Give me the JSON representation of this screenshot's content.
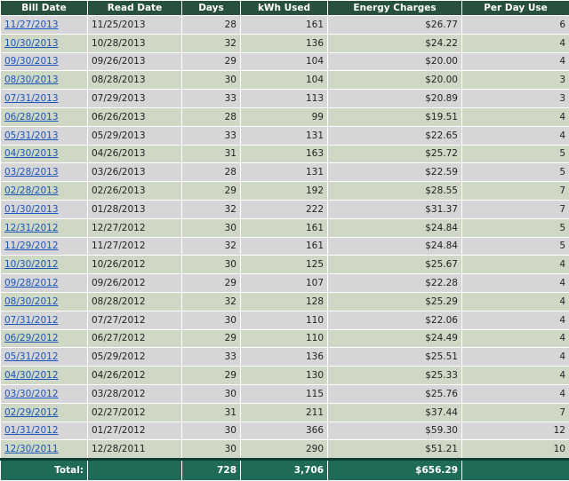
{
  "headers": {
    "bill_date": "Bill Date",
    "read_date": "Read Date",
    "days": "Days",
    "kwh": "kWh Used",
    "charges": "Energy Charges",
    "per_day": "Per Day Use"
  },
  "rows": [
    {
      "bill_date": "11/27/2013",
      "read_date": "11/25/2013",
      "days": "28",
      "kwh": "161",
      "charges": "$26.77",
      "per_day": "6"
    },
    {
      "bill_date": "10/30/2013",
      "read_date": "10/28/2013",
      "days": "32",
      "kwh": "136",
      "charges": "$24.22",
      "per_day": "4"
    },
    {
      "bill_date": "09/30/2013",
      "read_date": "09/26/2013",
      "days": "29",
      "kwh": "104",
      "charges": "$20.00",
      "per_day": "4"
    },
    {
      "bill_date": "08/30/2013",
      "read_date": "08/28/2013",
      "days": "30",
      "kwh": "104",
      "charges": "$20.00",
      "per_day": "3"
    },
    {
      "bill_date": "07/31/2013",
      "read_date": "07/29/2013",
      "days": "33",
      "kwh": "113",
      "charges": "$20.89",
      "per_day": "3"
    },
    {
      "bill_date": "06/28/2013",
      "read_date": "06/26/2013",
      "days": "28",
      "kwh": "99",
      "charges": "$19.51",
      "per_day": "4"
    },
    {
      "bill_date": "05/31/2013",
      "read_date": "05/29/2013",
      "days": "33",
      "kwh": "131",
      "charges": "$22.65",
      "per_day": "4"
    },
    {
      "bill_date": "04/30/2013",
      "read_date": "04/26/2013",
      "days": "31",
      "kwh": "163",
      "charges": "$25.72",
      "per_day": "5"
    },
    {
      "bill_date": "03/28/2013",
      "read_date": "03/26/2013",
      "days": "28",
      "kwh": "131",
      "charges": "$22.59",
      "per_day": "5"
    },
    {
      "bill_date": "02/28/2013",
      "read_date": "02/26/2013",
      "days": "29",
      "kwh": "192",
      "charges": "$28.55",
      "per_day": "7"
    },
    {
      "bill_date": "01/30/2013",
      "read_date": "01/28/2013",
      "days": "32",
      "kwh": "222",
      "charges": "$31.37",
      "per_day": "7"
    },
    {
      "bill_date": "12/31/2012",
      "read_date": "12/27/2012",
      "days": "30",
      "kwh": "161",
      "charges": "$24.84",
      "per_day": "5"
    },
    {
      "bill_date": "11/29/2012",
      "read_date": "11/27/2012",
      "days": "32",
      "kwh": "161",
      "charges": "$24.84",
      "per_day": "5"
    },
    {
      "bill_date": "10/30/2012",
      "read_date": "10/26/2012",
      "days": "30",
      "kwh": "125",
      "charges": "$25.67",
      "per_day": "4"
    },
    {
      "bill_date": "09/28/2012",
      "read_date": "09/26/2012",
      "days": "29",
      "kwh": "107",
      "charges": "$22.28",
      "per_day": "4"
    },
    {
      "bill_date": "08/30/2012",
      "read_date": "08/28/2012",
      "days": "32",
      "kwh": "128",
      "charges": "$25.29",
      "per_day": "4"
    },
    {
      "bill_date": "07/31/2012",
      "read_date": "07/27/2012",
      "days": "30",
      "kwh": "110",
      "charges": "$22.06",
      "per_day": "4"
    },
    {
      "bill_date": "06/29/2012",
      "read_date": "06/27/2012",
      "days": "29",
      "kwh": "110",
      "charges": "$24.49",
      "per_day": "4"
    },
    {
      "bill_date": "05/31/2012",
      "read_date": "05/29/2012",
      "days": "33",
      "kwh": "136",
      "charges": "$25.51",
      "per_day": "4"
    },
    {
      "bill_date": "04/30/2012",
      "read_date": "04/26/2012",
      "days": "29",
      "kwh": "130",
      "charges": "$25.33",
      "per_day": "4"
    },
    {
      "bill_date": "03/30/2012",
      "read_date": "03/28/2012",
      "days": "30",
      "kwh": "115",
      "charges": "$25.76",
      "per_day": "4"
    },
    {
      "bill_date": "02/29/2012",
      "read_date": "02/27/2012",
      "days": "31",
      "kwh": "211",
      "charges": "$37.44",
      "per_day": "7"
    },
    {
      "bill_date": "01/31/2012",
      "read_date": "01/27/2012",
      "days": "30",
      "kwh": "366",
      "charges": "$59.30",
      "per_day": "12"
    },
    {
      "bill_date": "12/30/2011",
      "read_date": "12/28/2011",
      "days": "30",
      "kwh": "290",
      "charges": "$51.21",
      "per_day": "10"
    }
  ],
  "totals": {
    "label": "Total:",
    "days": "728",
    "kwh": "3,706",
    "charges": "$656.29",
    "per_day": ""
  },
  "colors": {
    "header_bg": "#27503f",
    "row_odd": "#d6d6d8",
    "row_even": "#cfd8c5",
    "total_bg": "#1f6b57",
    "link": "#1a55b8"
  }
}
